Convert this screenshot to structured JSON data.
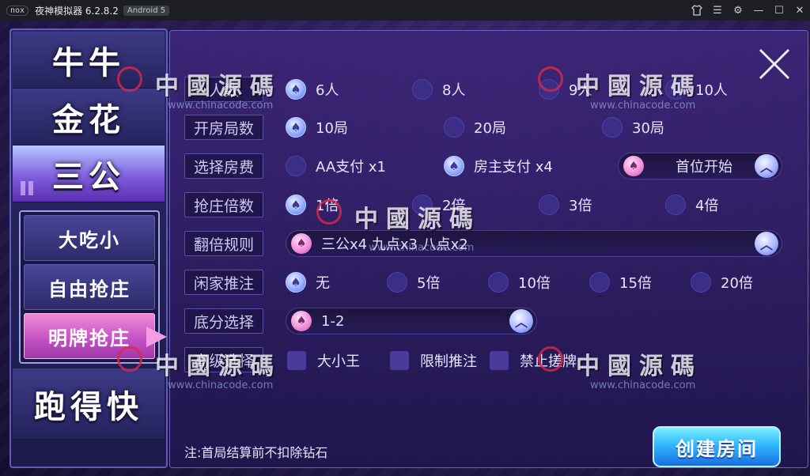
{
  "window": {
    "logo": "nox",
    "title": "夜神模拟器 6.2.8.2",
    "badge": "Android 5",
    "controls": [
      "shirt-icon",
      "menu-icon",
      "gear-icon",
      "minimize-icon",
      "maximize-icon",
      "close-icon"
    ]
  },
  "sidebar": {
    "main_items": [
      {
        "label": "牛牛"
      },
      {
        "label": "金花"
      },
      {
        "label": "三公"
      },
      {
        "label": "跑得快"
      }
    ],
    "sub_items": [
      {
        "label": "大吃小"
      },
      {
        "label": "自由抢庄"
      },
      {
        "label": "明牌抢庄"
      }
    ]
  },
  "form": {
    "rows": [
      {
        "label": "人数",
        "options": [
          "6人",
          "8人",
          "9人",
          "10人"
        ],
        "selected": 0
      },
      {
        "label": "开房局数",
        "options": [
          "10局",
          "20局",
          "30局"
        ],
        "selected": 0
      },
      {
        "label": "选择房费",
        "options": [
          "AA支付 x1",
          "房主支付 x4"
        ],
        "selected": 1,
        "dropdown": "首位开始"
      },
      {
        "label": "抢庄倍数",
        "options": [
          "1倍",
          "2倍",
          "3倍",
          "4倍"
        ],
        "selected": 0
      },
      {
        "label": "翻倍规则",
        "dropdown": "三公x4  九点x3  八点x2"
      },
      {
        "label": "闲家推注",
        "options": [
          "无",
          "5倍",
          "10倍",
          "15倍",
          "20倍"
        ],
        "selected": 0
      },
      {
        "label": "底分选择",
        "dropdown": "1-2"
      },
      {
        "label": "高级选择",
        "checkboxes": [
          "大小王",
          "限制推注",
          "禁止搓牌"
        ]
      }
    ]
  },
  "note": "注:首局结算前不扣除钻石",
  "create_button": "创建房间",
  "watermark": {
    "text": "中國源碼",
    "url": "www.chinacode.com"
  }
}
